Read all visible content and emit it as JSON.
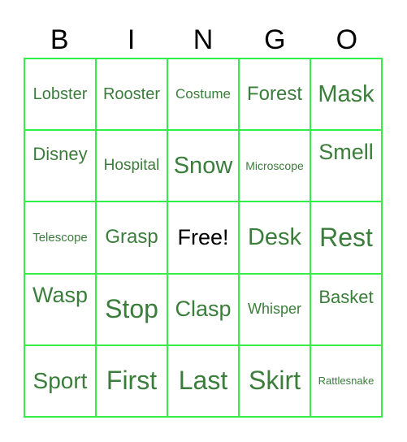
{
  "header": [
    "B",
    "I",
    "N",
    "G",
    "O"
  ],
  "colors": {
    "border": "#33ee44",
    "text": "#3b7d3b",
    "free_text": "#000000"
  },
  "cells": [
    [
      "Lobster",
      "Rooster",
      "Costume",
      "Forest",
      "Mask"
    ],
    [
      "Disney",
      "Hospital",
      "Snow",
      "Microscope",
      "Smell"
    ],
    [
      "Telescope",
      "Grasp",
      "Free!",
      "Desk",
      "Rest"
    ],
    [
      "Wasp",
      "Stop",
      "Clasp",
      "Whisper",
      "Basket"
    ],
    [
      "Sport",
      "First",
      "Last",
      "Skirt",
      "Rattlesnake"
    ]
  ]
}
